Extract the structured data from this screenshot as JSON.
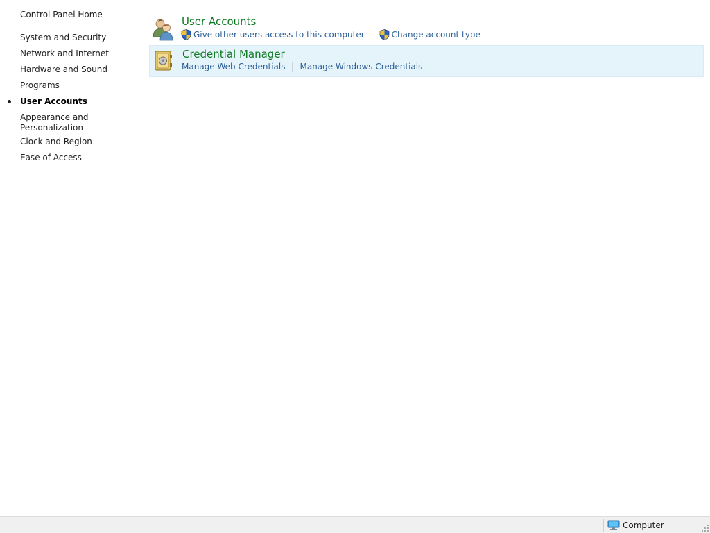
{
  "nav": {
    "home": "Control Panel Home",
    "items": [
      {
        "label": "System and Security"
      },
      {
        "label": "Network and Internet"
      },
      {
        "label": "Hardware and Sound"
      },
      {
        "label": "Programs"
      },
      {
        "label": "User Accounts",
        "current": true
      },
      {
        "label": "Appearance and\nPersonalization"
      },
      {
        "label": "Clock and Region"
      },
      {
        "label": "Ease of Access"
      }
    ]
  },
  "categories": [
    {
      "title": "User Accounts",
      "icon": "users-icon",
      "links": [
        {
          "label": "Give other users access to this computer",
          "icon": "uac-shield-icon"
        },
        {
          "label": "Change account type",
          "icon": "uac-shield-icon"
        }
      ]
    },
    {
      "title": "Credential Manager",
      "icon": "credential-vault-icon",
      "links": [
        {
          "label": "Manage Web Credentials"
        },
        {
          "label": "Manage Windows Credentials"
        }
      ]
    }
  ],
  "statusbar": {
    "location": "Computer",
    "icon": "computer-monitor-icon"
  },
  "colors": {
    "category_title": "#0e7a21",
    "task_link": "#2b5f96",
    "hover_background": "#e5f3fb"
  }
}
